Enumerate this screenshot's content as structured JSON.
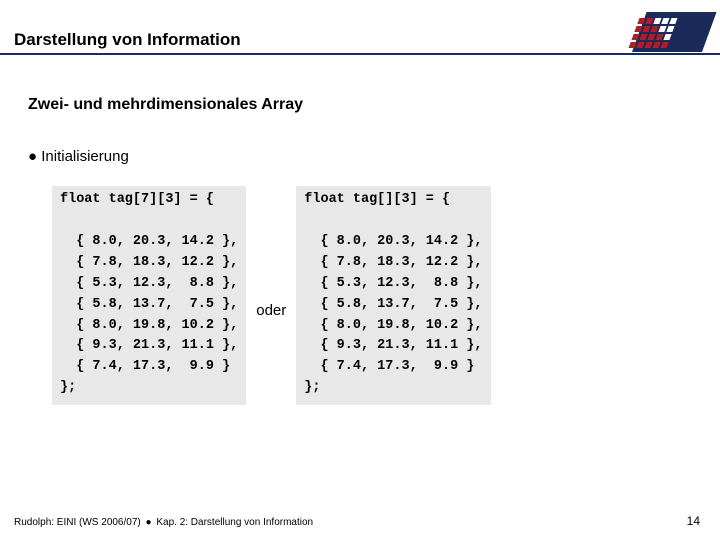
{
  "header": {
    "title": "Darstellung von Information"
  },
  "subheading": "Zwei- und mehrdimensionales Array",
  "bullet": {
    "marker": "●",
    "text": "Initialisierung"
  },
  "code": {
    "left": "float tag[7][3] = {\n\n  { 8.0, 20.3, 14.2 },\n  { 7.8, 18.3, 12.2 },\n  { 5.3, 12.3,  8.8 },\n  { 5.8, 13.7,  7.5 },\n  { 8.0, 19.8, 10.2 },\n  { 9.3, 21.3, 11.1 },\n  { 7.4, 17.3,  9.9 }\n};",
    "separator": "oder",
    "right": "float tag[][3] = {\n\n  { 8.0, 20.3, 14.2 },\n  { 7.8, 18.3, 12.2 },\n  { 5.3, 12.3,  8.8 },\n  { 5.8, 13.7,  7.5 },\n  { 8.0, 19.8, 10.2 },\n  { 9.3, 21.3, 11.1 },\n  { 7.4, 17.3,  9.9 }\n};"
  },
  "footer": {
    "left_a": "Rudolph: EINI (WS 2006/07)",
    "dot": "●",
    "left_b": "Kap. 2: Darstellung von Information",
    "page": "14"
  }
}
